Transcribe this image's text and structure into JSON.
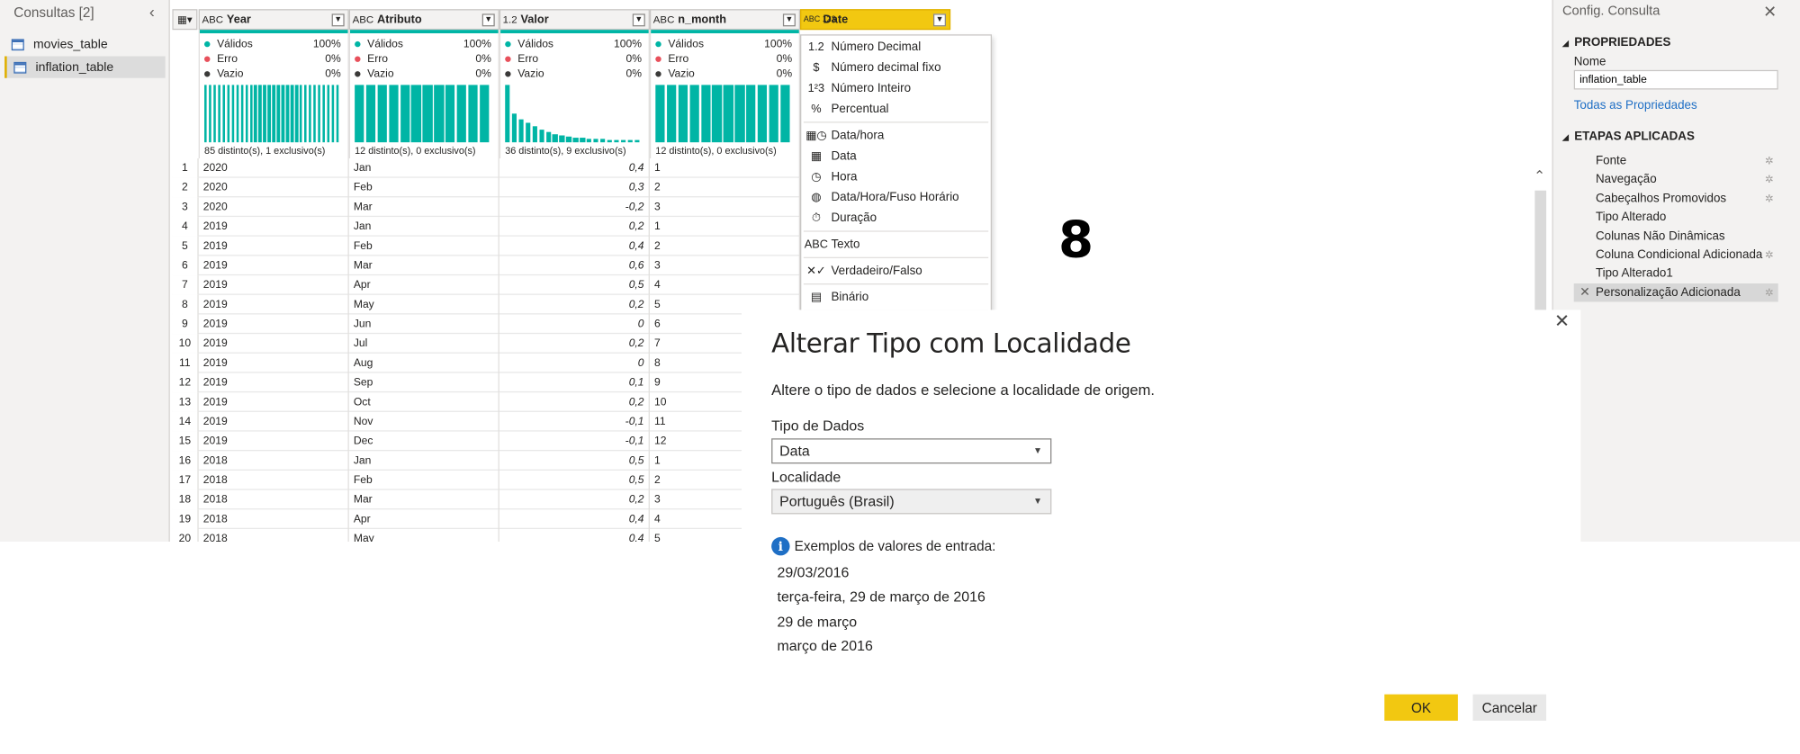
{
  "queries": {
    "title": "Consultas [2]",
    "collapse_glyph": "‹",
    "items": [
      {
        "label": "movies_table",
        "selected": false
      },
      {
        "label": "inflation_table",
        "selected": true
      }
    ]
  },
  "grid": {
    "columns": [
      {
        "type": "ABC",
        "name": "Year",
        "valid_label": "Válidos",
        "valid": "100%",
        "error_label": "Erro",
        "error": "0%",
        "empty_label": "Vazio",
        "empty": "0%",
        "distinct": "85 distinto(s), 1 exclusivo(s)"
      },
      {
        "type": "ABC",
        "name": "Atributo",
        "valid_label": "Válidos",
        "valid": "100%",
        "error_label": "Erro",
        "error": "0%",
        "empty_label": "Vazio",
        "empty": "0%",
        "distinct": "12 distinto(s), 0 exclusivo(s)"
      },
      {
        "type": "1.2",
        "name": "Valor",
        "valid_label": "Válidos",
        "valid": "100%",
        "error_label": "Erro",
        "error": "0%",
        "empty_label": "Vazio",
        "empty": "0%",
        "distinct": "36 distinto(s), 9 exclusivo(s)"
      },
      {
        "type": "ABC",
        "name": "n_month",
        "valid_label": "Válidos",
        "valid": "100%",
        "error_label": "Erro",
        "error": "0%",
        "empty_label": "Vazio",
        "empty": "0%",
        "distinct": "12 distinto(s), 0 exclusivo(s)"
      },
      {
        "type": "ABC 123",
        "name": "Date"
      }
    ],
    "rows": [
      [
        "1",
        "2020",
        "Jan",
        "0,4",
        "1"
      ],
      [
        "2",
        "2020",
        "Feb",
        "0,3",
        "2"
      ],
      [
        "3",
        "2020",
        "Mar",
        "-0,2",
        "3"
      ],
      [
        "4",
        "2019",
        "Jan",
        "0,2",
        "1"
      ],
      [
        "5",
        "2019",
        "Feb",
        "0,4",
        "2"
      ],
      [
        "6",
        "2019",
        "Mar",
        "0,6",
        "3"
      ],
      [
        "7",
        "2019",
        "Apr",
        "0,5",
        "4"
      ],
      [
        "8",
        "2019",
        "May",
        "0,2",
        "5"
      ],
      [
        "9",
        "2019",
        "Jun",
        "0",
        "6"
      ],
      [
        "10",
        "2019",
        "Jul",
        "0,2",
        "7"
      ],
      [
        "11",
        "2019",
        "Aug",
        "0",
        "8"
      ],
      [
        "12",
        "2019",
        "Sep",
        "0,1",
        "9"
      ],
      [
        "13",
        "2019",
        "Oct",
        "0,2",
        "10"
      ],
      [
        "14",
        "2019",
        "Nov",
        "-0,1",
        "11"
      ],
      [
        "15",
        "2019",
        "Dec",
        "-0,1",
        "12"
      ],
      [
        "16",
        "2018",
        "Jan",
        "0,5",
        "1"
      ],
      [
        "17",
        "2018",
        "Feb",
        "0,5",
        "2"
      ],
      [
        "18",
        "2018",
        "Mar",
        "0,2",
        "3"
      ],
      [
        "19",
        "2018",
        "Apr",
        "0,4",
        "4"
      ],
      [
        "20",
        "2018",
        "May",
        "0,4",
        "5"
      ]
    ]
  },
  "type_menu": {
    "items": [
      {
        "icon": "1.2",
        "label": "Número Decimal"
      },
      {
        "icon": "$",
        "label": "Número decimal fixo"
      },
      {
        "icon": "1²3",
        "label": "Número Inteiro"
      },
      {
        "icon": "%",
        "label": "Percentual"
      },
      {
        "icon": "▦◷",
        "label": "Data/hora"
      },
      {
        "icon": "▦",
        "label": "Data"
      },
      {
        "icon": "◷",
        "label": "Hora"
      },
      {
        "icon": "◍",
        "label": "Data/Hora/Fuso Horário"
      },
      {
        "icon": "⏱",
        "label": "Duração"
      },
      {
        "icon": "ABC",
        "label": "Texto"
      },
      {
        "icon": "✕✓",
        "label": "Verdadeiro/Falso"
      },
      {
        "icon": "▤",
        "label": "Binário"
      }
    ]
  },
  "step_number": "8",
  "settings": {
    "title": "Config. Consulta",
    "close_glyph": "✕",
    "properties_header": "PROPRIEDADES",
    "name_label": "Nome",
    "name_value": "inflation_table",
    "all_properties": "Todas as Propriedades",
    "steps_header": "ETAPAS APLICADAS",
    "steps": [
      {
        "label": "Fonte",
        "gear": true
      },
      {
        "label": "Navegação",
        "gear": true
      },
      {
        "label": "Cabeçalhos Promovidos",
        "gear": true
      },
      {
        "label": "Tipo Alterado",
        "gear": false
      },
      {
        "label": "Colunas Não Dinâmicas",
        "gear": false
      },
      {
        "label": "Coluna Condicional Adicionada",
        "gear": true
      },
      {
        "label": "Tipo Alterado1",
        "gear": false
      },
      {
        "label": "Personalização Adicionada",
        "gear": true,
        "selected": true
      }
    ]
  },
  "dialog": {
    "title": "Alterar Tipo com Localidade",
    "description": "Altere o tipo de dados e selecione a localidade de origem.",
    "type_label": "Tipo de Dados",
    "type_value": "Data",
    "locale_label": "Localidade",
    "locale_value": "Português (Brasil)",
    "examples_header": "Exemplos de valores de entrada:",
    "examples": [
      "29/03/2016",
      "terça-feira, 29 de março de 2016",
      "29 de março",
      "março de 2016"
    ],
    "ok_label": "OK",
    "cancel_label": "Cancelar",
    "close_glyph": "✕"
  },
  "colors": {
    "accent": "#f2c811",
    "quality_bar": "#00b5a5",
    "link": "#1f6fc5",
    "valid_dot": "#00b5a5",
    "error_dot": "#e8505b",
    "empty_dot": "#3b3a39"
  },
  "histograms": {
    "year": [
      1,
      1,
      1,
      1,
      1,
      1,
      1,
      1,
      1,
      1,
      1,
      1,
      1,
      1,
      1,
      1,
      1,
      1,
      1,
      1,
      1,
      1,
      1,
      1,
      1,
      1,
      1,
      1,
      1,
      1
    ],
    "atributo": [
      1,
      1,
      1,
      1,
      1,
      1,
      1,
      1,
      1,
      1,
      1,
      1
    ],
    "valor": [
      1,
      0.5,
      0.4,
      0.35,
      0.28,
      0.22,
      0.18,
      0.15,
      0.12,
      0.1,
      0.09,
      0.08,
      0.07,
      0.06,
      0.06,
      0.05,
      0.05,
      0.04,
      0.04,
      0.04
    ],
    "n_month": [
      1,
      1,
      1,
      1,
      1,
      1,
      1,
      1,
      1,
      1,
      1,
      1
    ]
  }
}
